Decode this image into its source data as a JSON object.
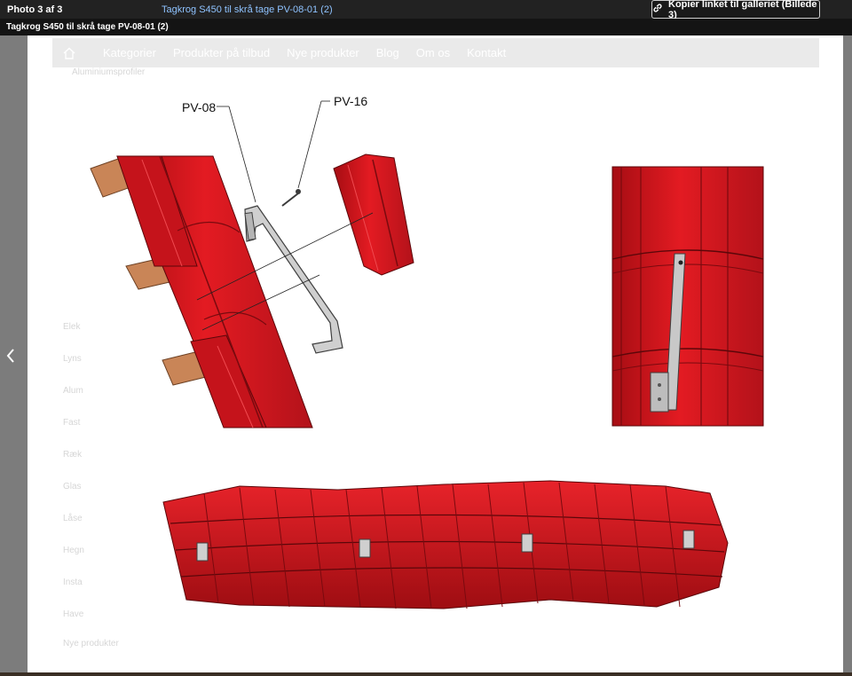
{
  "topbar": {
    "photo_count": "Photo 3 af 3",
    "title_link": "Tagkrog S450 til skrå tage PV-08-01 (2)",
    "copy_label": "Kopier linket til galleriet (Billede 3)"
  },
  "caption": "Tagkrog S450 til skrå tage PV-08-01 (2)",
  "background_nav": {
    "items": [
      "Kategorier",
      "Produkter på tilbud",
      "Nye produkter",
      "Blog",
      "Om os",
      "Kontakt"
    ]
  },
  "background_sidebar": {
    "items": [
      "Aluminiumsprofiler",
      "Elek",
      "Lyns",
      "Alum",
      "Fast",
      "Ræk",
      "Glas",
      "Låse",
      "Hegn",
      "Insta",
      "Have",
      "Nye produkter"
    ]
  },
  "drawing": {
    "labels": {
      "hook": "PV-08",
      "screw": "PV-16"
    }
  },
  "colors": {
    "roof_red": "#d6141c",
    "roof_dark": "#a60d13",
    "batten": "#c98557",
    "hook_steel": "#c7c7c7"
  },
  "icons": {
    "copy": "link-icon",
    "prev": "chevron-left-icon",
    "home": "home-icon"
  }
}
